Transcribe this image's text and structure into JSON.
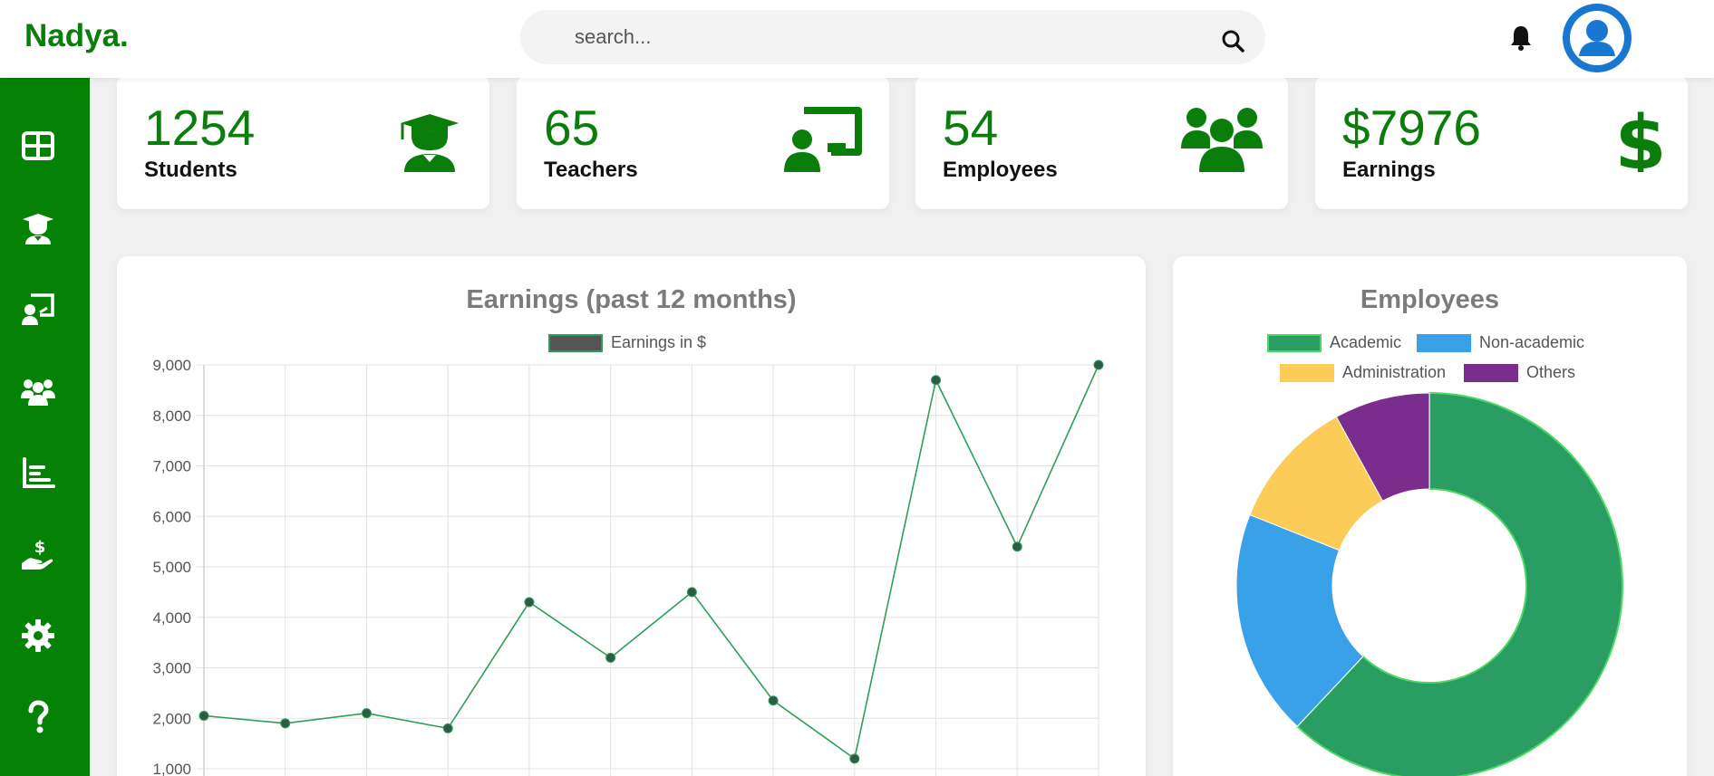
{
  "brand": "Nadya.",
  "search": {
    "placeholder": "search..."
  },
  "colors": {
    "accent": "#058105",
    "brand_text": "#0a7d0a",
    "avatar": "#1777d1"
  },
  "sidebar": {
    "items": [
      {
        "icon": "grid-icon"
      },
      {
        "icon": "graduate-icon"
      },
      {
        "icon": "teacher-icon"
      },
      {
        "icon": "users-icon"
      },
      {
        "icon": "chart-icon"
      },
      {
        "icon": "hand-dollar-icon"
      },
      {
        "icon": "gear-icon"
      },
      {
        "icon": "question-icon"
      }
    ]
  },
  "stats": [
    {
      "value": "1254",
      "label": "Students",
      "icon": "graduate-icon"
    },
    {
      "value": "65",
      "label": "Teachers",
      "icon": "teacher-icon"
    },
    {
      "value": "54",
      "label": "Employees",
      "icon": "users-icon"
    },
    {
      "value": "$7976",
      "label": "Earnings",
      "icon": "dollar-icon"
    }
  ],
  "earnings_panel": {
    "title": "Earnings (past 12 months)"
  },
  "employees_panel": {
    "title": "Employees"
  },
  "chart_data": [
    {
      "type": "line",
      "title": "Earnings (past 12 months)",
      "series": [
        {
          "name": "Earnings in $",
          "values": [
            2050,
            1900,
            2100,
            1800,
            4300,
            3200,
            4500,
            2350,
            1200,
            8700,
            5400,
            9000
          ],
          "color": "#2e9e5b"
        }
      ],
      "y_ticks": [
        "9,000",
        "8,000",
        "7,000",
        "6,000",
        "5,000",
        "4,000",
        "3,000",
        "2,000",
        "1,000"
      ],
      "ylim": [
        1000,
        9000
      ],
      "grid": true,
      "legend": "top"
    },
    {
      "type": "pie",
      "title": "Employees",
      "categories": [
        "Academic",
        "Non-academic",
        "Administration",
        "Others"
      ],
      "values": [
        62,
        19,
        11,
        8
      ],
      "colors": [
        "#2a9d62",
        "#39a1e8",
        "#fdcc58",
        "#7b2d8e"
      ],
      "legend": "top"
    }
  ]
}
